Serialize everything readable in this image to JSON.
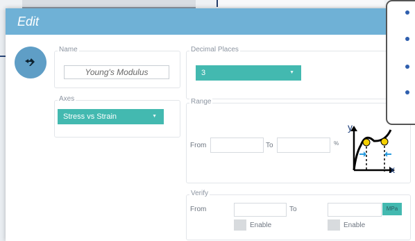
{
  "dialog": {
    "title": "Edit"
  },
  "name": {
    "legend": "Name",
    "value": "Young's Modulus"
  },
  "decimal_places": {
    "legend": "Decimal Places",
    "selected": "3"
  },
  "axes": {
    "legend": "Axes",
    "selected": "Stress vs Strain"
  },
  "range": {
    "legend": "Range",
    "from_label": "From",
    "to_label": "To",
    "unit": "%"
  },
  "graph": {
    "x_label": "x",
    "y_label": "y"
  },
  "verify": {
    "legend": "Verify",
    "from_label": "From",
    "to_label": "To",
    "unit": "MPa",
    "enable_label_1": "Enable",
    "enable_label_2": "Enable"
  },
  "tooltip": {
    "bullet_count": 4
  },
  "colors": {
    "title_bar": "#6fb1d6",
    "accent": "#43b9b0",
    "avatar": "#5f9ec6",
    "graph_point": "#f5d000",
    "graph_arrow": "#2a9de0"
  }
}
